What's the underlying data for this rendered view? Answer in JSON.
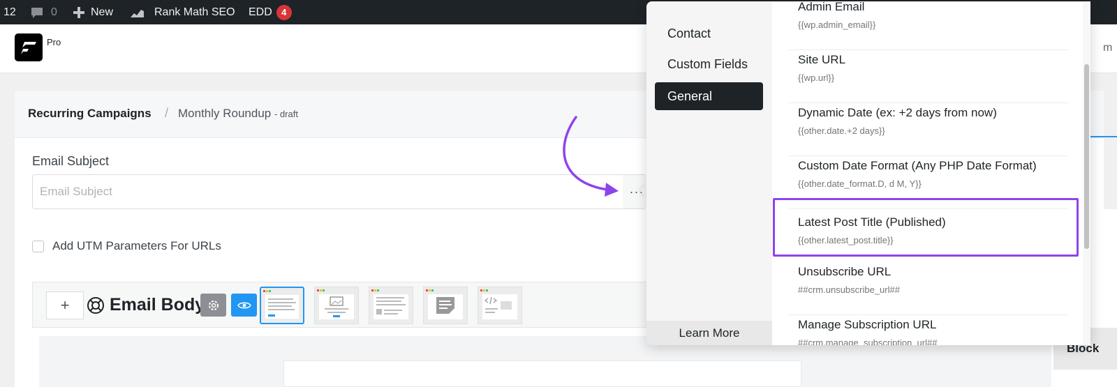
{
  "admin_bar": {
    "update_count": "12",
    "comment_count": "0",
    "new_label": "New",
    "seo_label": "Rank Math SEO",
    "edd_label": "EDD",
    "edd_badge": "4"
  },
  "header": {
    "pro_label": "Pro",
    "edge_text": "m"
  },
  "breadcrumb": {
    "parent": "Recurring Campaigns",
    "separator": "/",
    "current": "Monthly Roundup",
    "status": "- draft"
  },
  "email_subject": {
    "label": "Email Subject",
    "placeholder": "Email Subject",
    "value": "",
    "more_label": "···"
  },
  "utm": {
    "label": "Add UTM Parameters For URLs",
    "checked": false
  },
  "editor": {
    "add_label": "+",
    "title": "Email Body",
    "side_tab_text": "Block"
  },
  "popover": {
    "categories": [
      {
        "label": "Contact",
        "active": false
      },
      {
        "label": "Custom Fields",
        "active": false
      },
      {
        "label": "General",
        "active": true
      }
    ],
    "learn_more": "Learn More",
    "items": [
      {
        "title": "Admin Email",
        "code": "{{wp.admin_email}}"
      },
      {
        "title": "Site URL",
        "code": "{{wp.url}}"
      },
      {
        "title": "Dynamic Date (ex: +2 days from now)",
        "code": "{{other.date.+2 days}}"
      },
      {
        "title": "Custom Date Format (Any PHP Date Format)",
        "code": "{{other.date_format.D, d M, Y}}"
      },
      {
        "title": "Latest Post Title (Published)",
        "code": "{{other.latest_post.title}}"
      },
      {
        "title": "Unsubscribe URL",
        "code": "##crm.unsubscribe_url##"
      },
      {
        "title": "Manage Subscription URL",
        "code": "##crm.manage_subscription_url##"
      }
    ]
  },
  "colors": {
    "admin_bar_bg": "#1d2327",
    "badge_red": "#d63638",
    "accent_blue": "#2196f3",
    "highlight_purple": "#8e44ec",
    "active_category_bg": "#1d2327"
  }
}
